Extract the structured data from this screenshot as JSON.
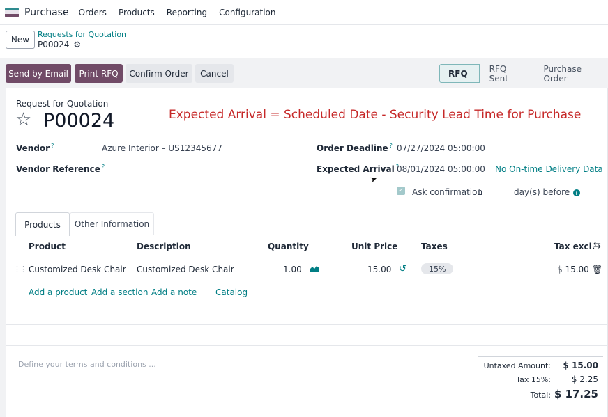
{
  "navbar": {
    "app_name": "Purchase",
    "menu": [
      "Orders",
      "Products",
      "Reporting",
      "Configuration"
    ],
    "logo_colors": [
      "#2e8b8f",
      "#f1f1f1",
      "#714b67"
    ]
  },
  "control_panel": {
    "new_label": "New",
    "breadcrumb_parent": "Requests for Quotation",
    "breadcrumb_current": "P00024"
  },
  "actions": {
    "send_by_email": "Send by Email",
    "print_rfq": "Print RFQ",
    "confirm_order": "Confirm Order",
    "cancel": "Cancel"
  },
  "statusbar": {
    "stages": [
      "RFQ",
      "RFQ Sent",
      "Purchase Order"
    ],
    "active": "RFQ"
  },
  "form": {
    "doc_type": "Request for Quotation",
    "name": "P00024",
    "annotation": "Expected Arrival = Scheduled Date - Security Lead Time for Purchase",
    "vendor_label": "Vendor",
    "vendor_value": "Azure Interior – US12345677",
    "vendor_ref_label": "Vendor Reference",
    "order_deadline_label": "Order Deadline",
    "order_deadline_value": "07/27/2024 05:00:00",
    "expected_arrival_label": "Expected Arrival",
    "expected_arrival_value": "08/01/2024 05:00:00",
    "delivery_data": "No On-time Delivery Data",
    "ask_confirmation_label": "Ask confirmation",
    "ask_confirmation_days": "1",
    "days_before": "day(s) before",
    "help_mark": "?"
  },
  "tabs": [
    "Products",
    "Other Information"
  ],
  "table": {
    "headers": [
      "Product",
      "Description",
      "Quantity",
      "Unit Price",
      "Taxes",
      "Tax excl."
    ],
    "rows": [
      {
        "product": "Customized Desk Chair",
        "description": "Customized Desk Chair",
        "quantity": "1.00",
        "unit_price": "15.00",
        "tax": "15%",
        "subtotal": "$ 15.00"
      }
    ],
    "add_links": [
      "Add a product",
      "Add a section",
      "Add a note",
      "Catalog"
    ]
  },
  "footer": {
    "terms_placeholder": "Define your terms and conditions ...",
    "untaxed_label": "Untaxed Amount:",
    "untaxed_value": "$ 15.00",
    "tax_label": "Tax 15%:",
    "tax_value": "$ 2.25",
    "total_label": "Total:",
    "total_value": "$ 17.25"
  },
  "colors": {
    "brand": "#714b67",
    "accent": "#017e84",
    "annotation": "#c62828"
  }
}
